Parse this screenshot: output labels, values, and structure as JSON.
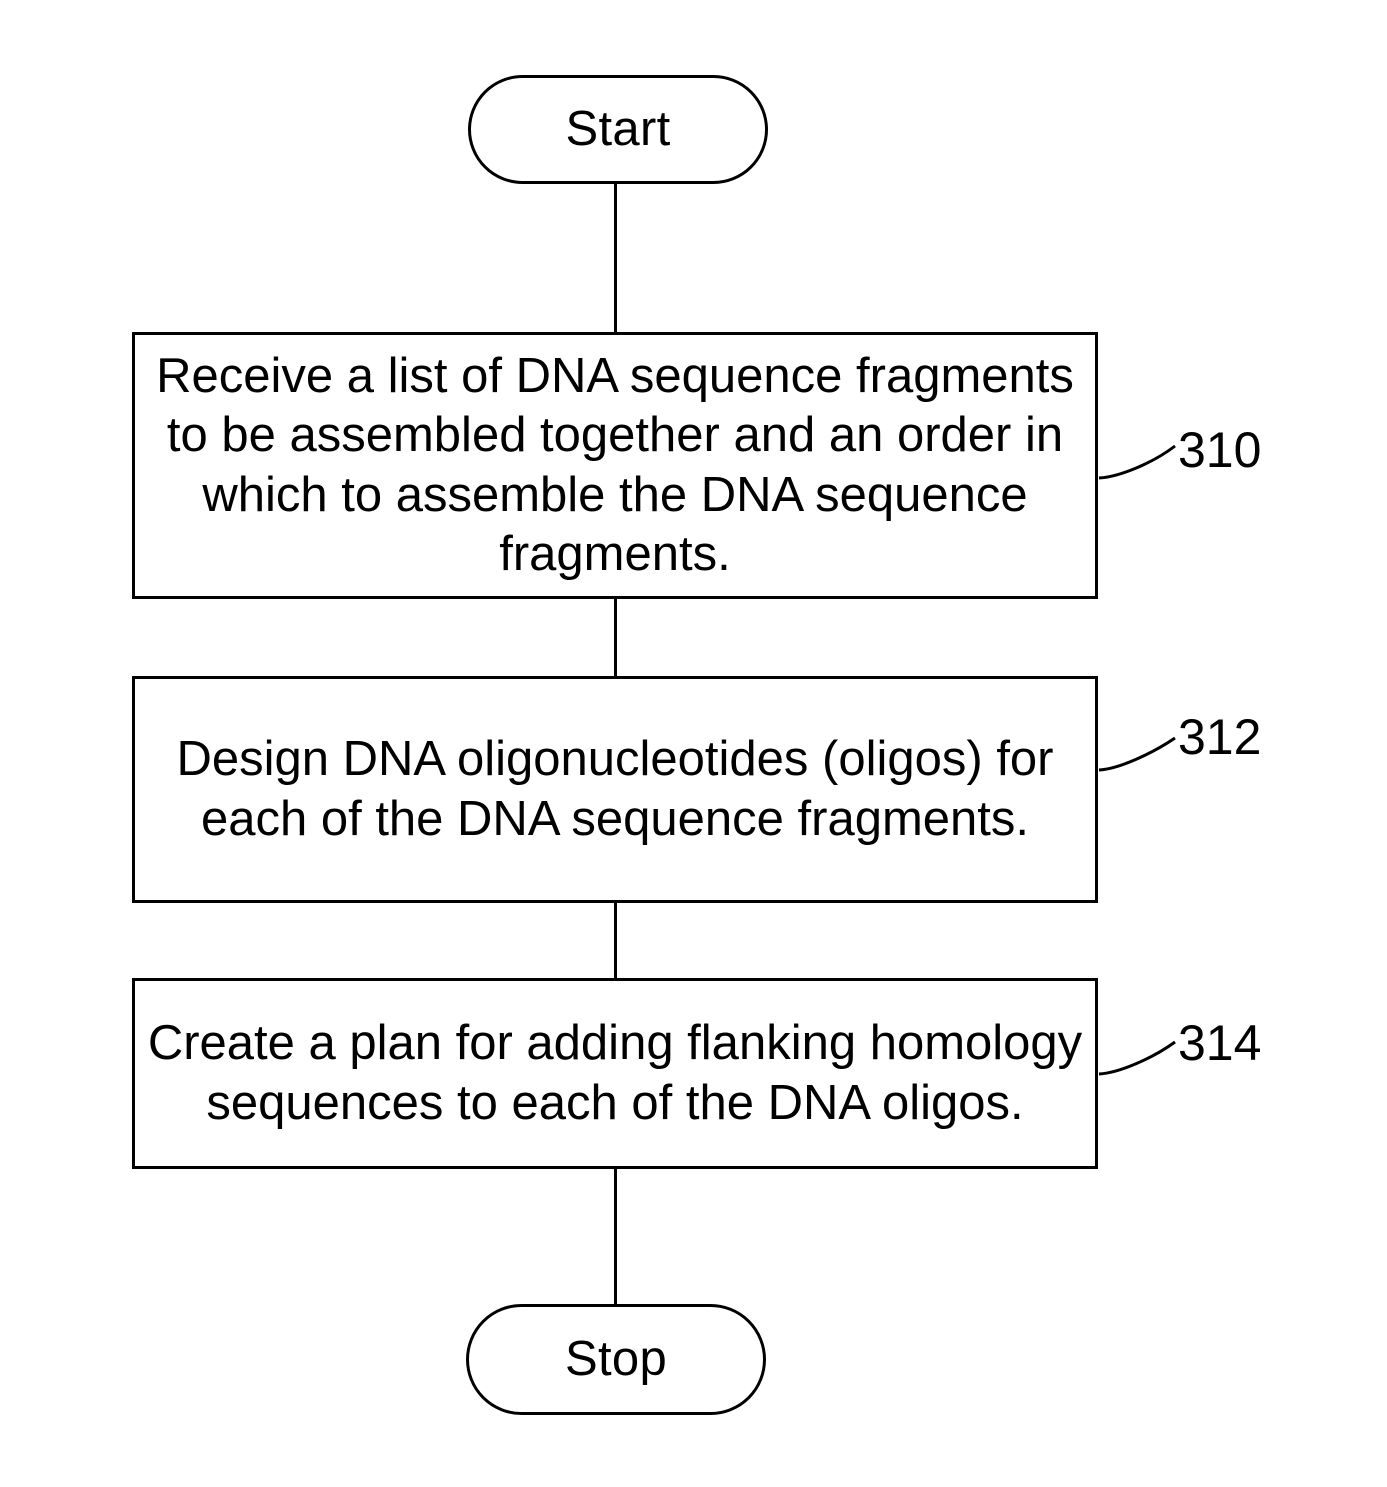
{
  "figure": {
    "type": "flowchart",
    "orientation": "vertical",
    "background_color": "#ffffff",
    "line_color": "#000000"
  },
  "nodes": {
    "start": {
      "label": "Start",
      "shape": "terminal"
    },
    "step310": {
      "label": "Receive a list of DNA sequence fragments to be assembled together and an order in which to assemble the DNA sequence fragments.",
      "shape": "process",
      "ref": "310"
    },
    "step312": {
      "label": "Design DNA oligonucleotides (oligos) for each of the DNA sequence fragments.",
      "shape": "process",
      "ref": "312"
    },
    "step314": {
      "label": "Create a plan for adding flanking homology sequences to each of the DNA oligos.",
      "shape": "process",
      "ref": "314"
    },
    "stop": {
      "label": "Stop",
      "shape": "terminal"
    }
  },
  "reference_numerals": [
    {
      "value": "310",
      "points_to": "step310"
    },
    {
      "value": "312",
      "points_to": "step312"
    },
    {
      "value": "314",
      "points_to": "step314"
    }
  ]
}
